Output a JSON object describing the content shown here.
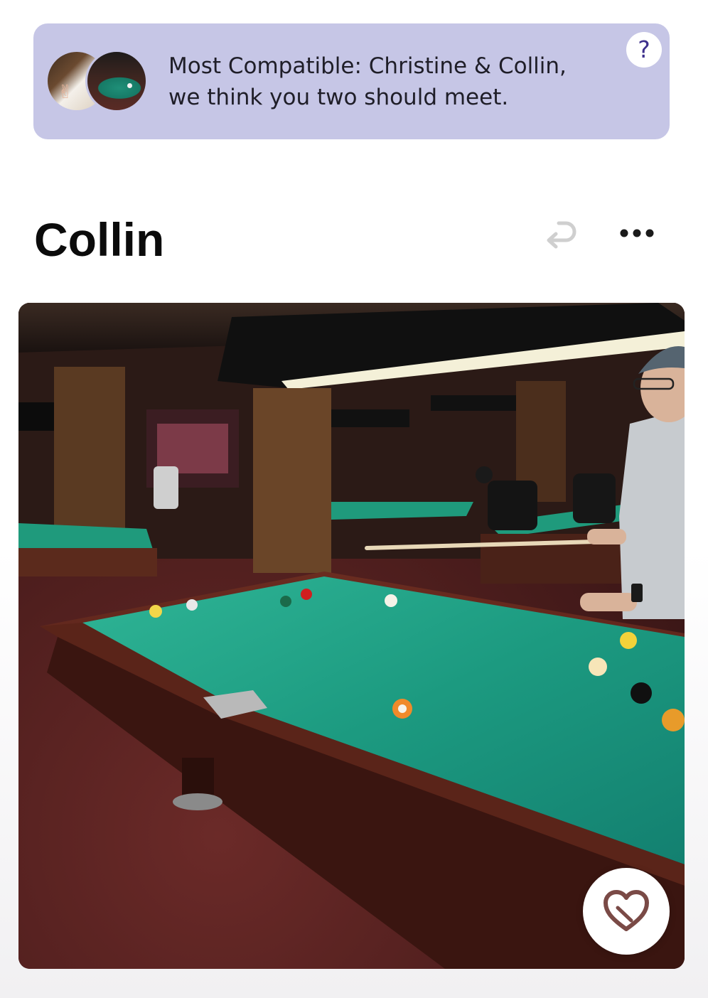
{
  "banner": {
    "line1": "Most Compatible: Christine & Collin,",
    "line2": "we think you two should meet.",
    "help_label": "?"
  },
  "profile": {
    "name": "Collin"
  },
  "icons": {
    "help": "question-icon",
    "undo": "undo-arrow-icon",
    "more": "more-dots-icon",
    "like": "heart-icon"
  },
  "colors": {
    "banner_bg": "#c6c6e6",
    "help_accent": "#3d2f8c",
    "heart": "#6b3a3a",
    "felt": "#1c9a80"
  }
}
